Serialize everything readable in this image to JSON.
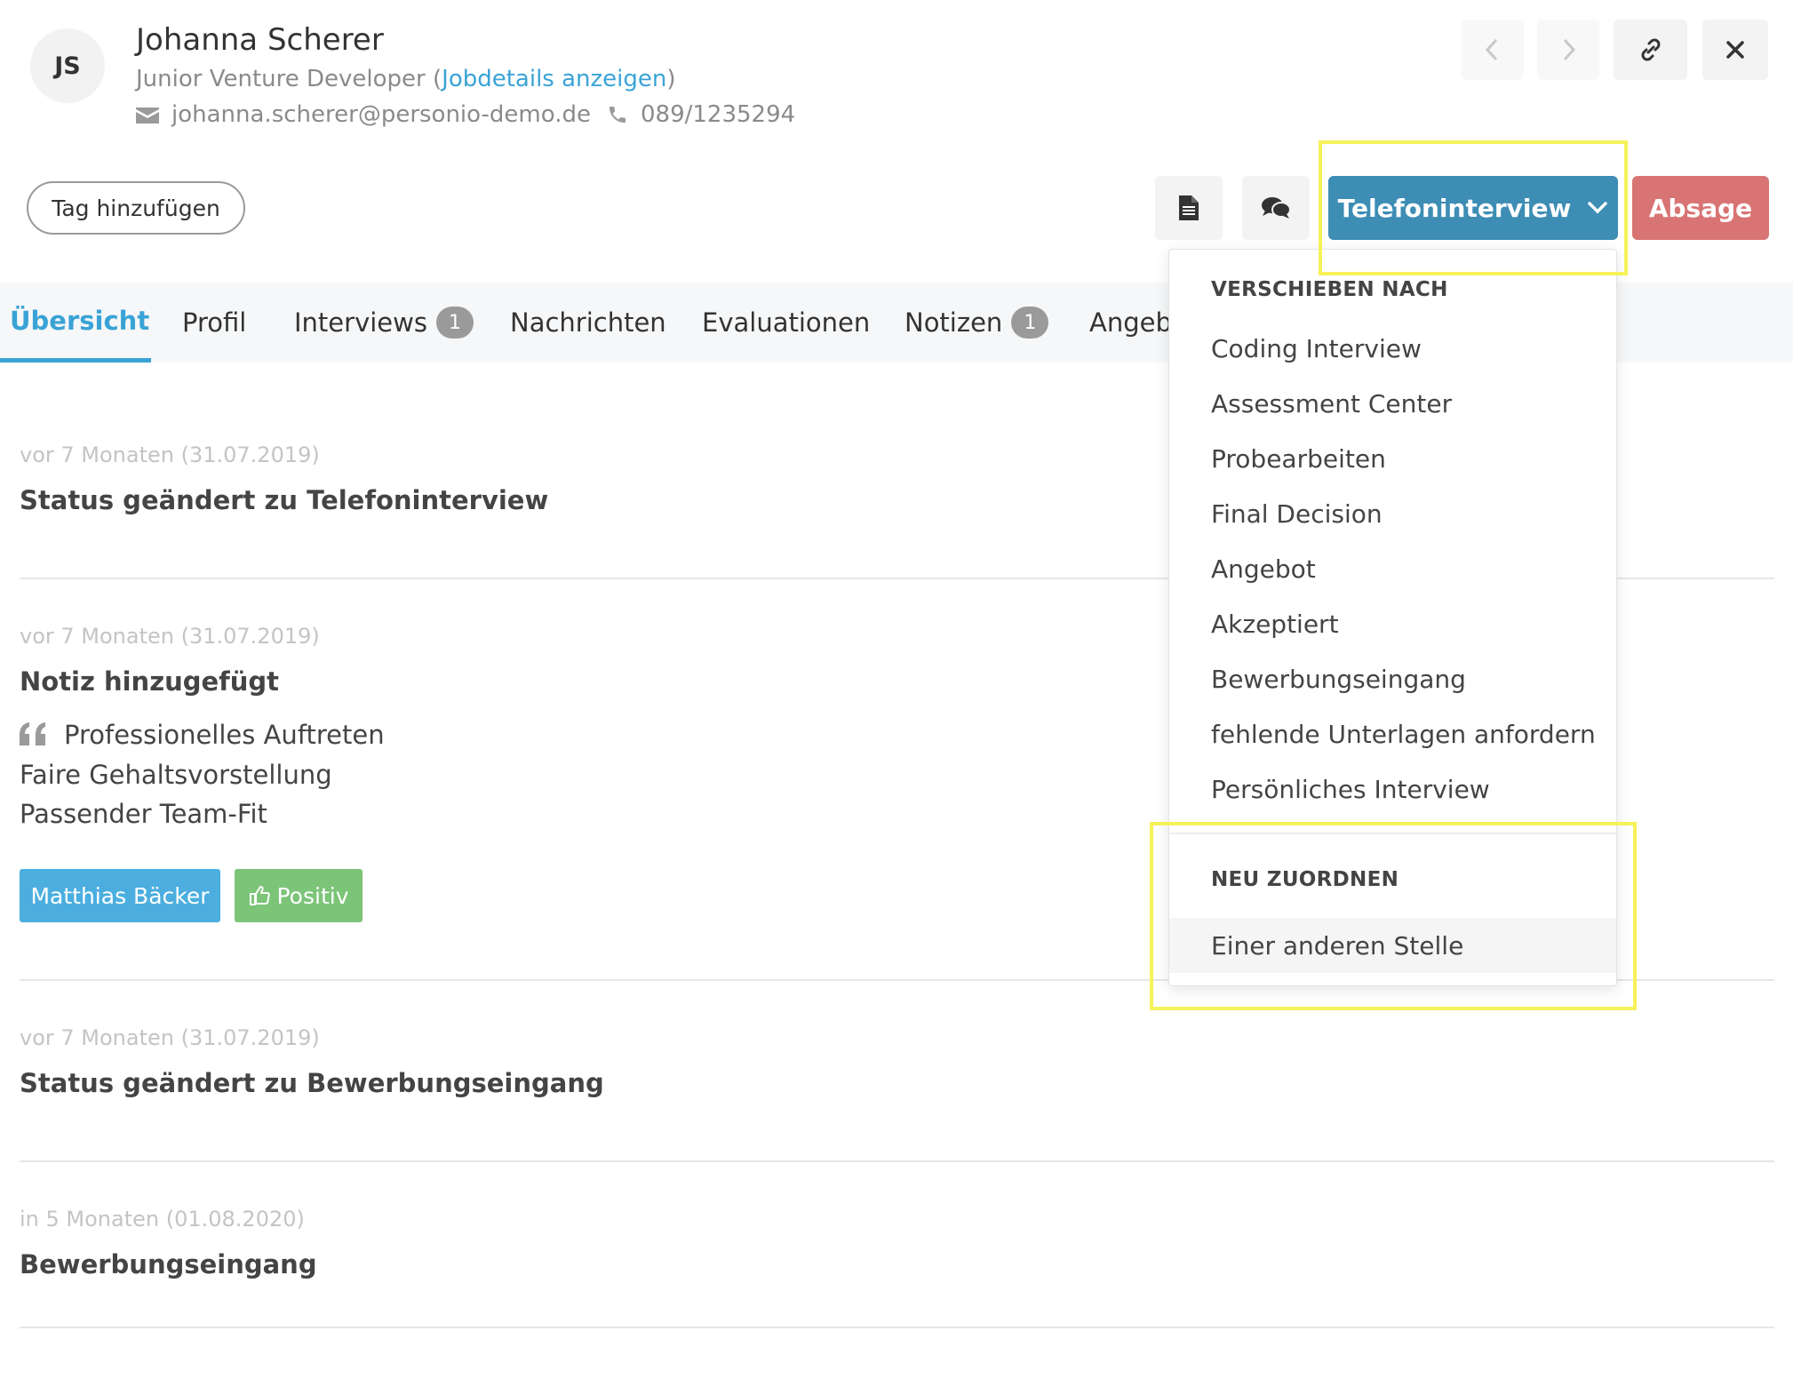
{
  "candidate": {
    "initials": "JS",
    "name": "Johanna Scherer",
    "job_title": "Junior Venture Developer",
    "job_paren_open": " (",
    "job_link": "Jobdetails anzeigen",
    "job_paren_close": ")",
    "email": "johanna.scherer@personio-demo.de",
    "phone": "089/1235294"
  },
  "actions": {
    "tag_button": "Tag hinzufügen",
    "status_button": "Telefoninterview",
    "reject_button": "Absage"
  },
  "tabs": [
    {
      "label": "Übersicht",
      "count": null
    },
    {
      "label": "Profil",
      "count": null
    },
    {
      "label": "Interviews",
      "count": "1"
    },
    {
      "label": "Nachrichten",
      "count": null
    },
    {
      "label": "Evaluationen",
      "count": null
    },
    {
      "label": "Notizen",
      "count": "1"
    },
    {
      "label": "Angebo",
      "count": null
    }
  ],
  "feed": [
    {
      "date": "vor 7 Monaten (31.07.2019)",
      "title": "Status geändert zu Telefoninterview"
    },
    {
      "date": "vor 7 Monaten (31.07.2019)",
      "title": "Notiz hinzugefügt",
      "note_lines": [
        "Professionelles Auftreten",
        "Faire Gehaltsvorstellung",
        "Passender Team-Fit"
      ],
      "author_chip": "Matthias Bäcker",
      "rating_chip": "Positiv"
    },
    {
      "date": "vor 7 Monaten (31.07.2019)",
      "title": "Status geändert zu Bewerbungseingang"
    },
    {
      "date": "in 5 Monaten (01.08.2020)",
      "title": "Bewerbungseingang"
    }
  ],
  "dropdown": {
    "move_header": "VERSCHIEBEN NACH",
    "move_items": [
      "Coding Interview",
      "Assessment Center",
      "Probearbeiten",
      "Final Decision",
      "Angebot",
      "Akzeptiert",
      "Bewerbungseingang",
      "fehlende Unterlagen anfordern",
      "Persönliches Interview"
    ],
    "reassign_header": "NEU ZUORDNEN",
    "reassign_items": [
      "Einer anderen Stelle"
    ]
  },
  "colors": {
    "accent": "#3aa3d6",
    "status_button": "#3d8db5",
    "reject_button": "#d97474",
    "chip_author": "#4baedf",
    "chip_positive": "#7cc478",
    "highlight": "#f5f25a"
  },
  "icons": [
    "mail-icon",
    "phone-icon",
    "chevron-left-icon",
    "chevron-right-icon",
    "link-icon",
    "close-icon",
    "document-icon",
    "comments-icon",
    "chevron-down-icon",
    "quote-icon",
    "thumbs-up-icon"
  ]
}
